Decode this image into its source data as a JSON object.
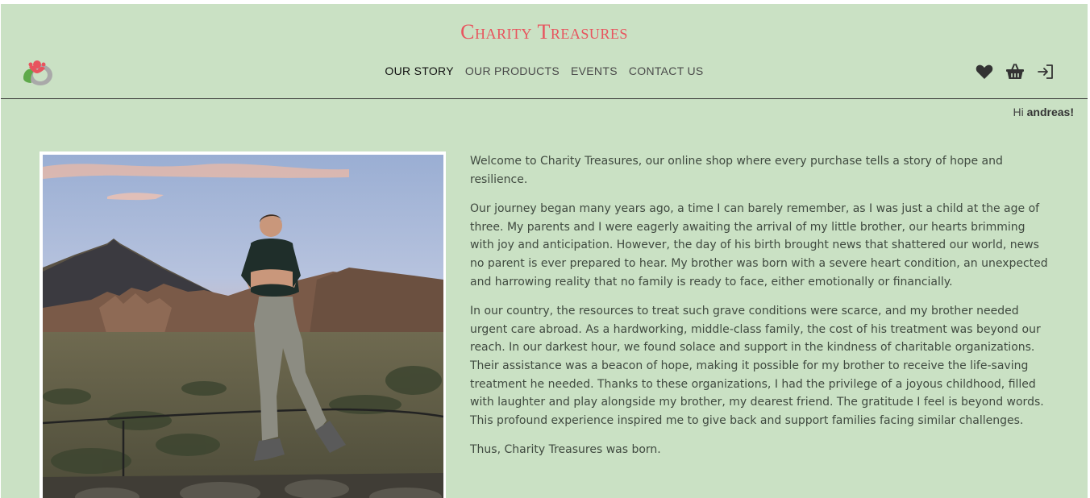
{
  "header": {
    "brand": "Charity Treasures",
    "logo_icon": "charity-logo-icon",
    "nav": [
      {
        "label": "OUR STORY",
        "active": true
      },
      {
        "label": "OUR PRODUCTS",
        "active": false
      },
      {
        "label": "EVENTS",
        "active": false
      },
      {
        "label": "CONTACT US",
        "active": false
      }
    ],
    "actions": [
      "heart-icon",
      "basket-icon",
      "login-icon"
    ]
  },
  "user": {
    "greeting_prefix": "Hi",
    "name": "andreas!"
  },
  "story": {
    "image_alt": "Man standing in front of a mountain at sunset",
    "paragraphs": [
      "Welcome to Charity Treasures, our online shop where every purchase tells a story of hope and resilience.",
      "Our journey began many years ago, a time I can barely remember, as I was just a child at the age of  three. My parents and I were eagerly awaiting the arrival of my little brother, our hearts brimming with joy and anticipation. However, the day of his birth brought news that shattered our world, news no parent is ever prepared to hear. My brother was born with a severe heart condition, an unexpected and harrowing reality that no family is ready to face, either emotionally or financially.",
      "In our country, the resources to treat such grave conditions were scarce, and my brother needed urgent care abroad. As a hardworking, middle-class family, the cost of his treatment was beyond our reach. In our darkest hour, we found solace and support in the kindness of charitable organizations. Their assistance was a beacon of hope, making it possible for my brother to receive the life-saving treatment he needed. Thanks to these organizations, I had the privilege of a joyous childhood, filled with laughter and play alongside my brother, my dearest friend. The gratitude I feel is beyond words. This profound experience inspired me to give back and support families facing similar challenges.",
      "Thus, Charity Treasures was born."
    ]
  },
  "colors": {
    "background": "#cae1c4",
    "brand": "#e8545e",
    "text": "#404a40"
  }
}
